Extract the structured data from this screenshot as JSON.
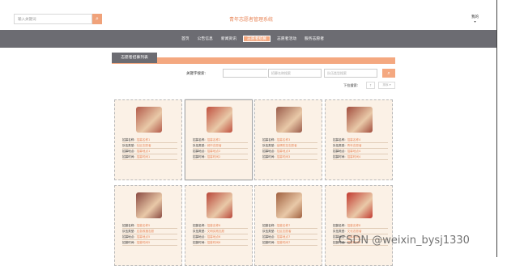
{
  "header": {
    "search_placeholder": "输入关键词",
    "search_icon": "search-icon",
    "title": "青年志愿者管理系统",
    "user_label": "我的",
    "user_caret": "▾"
  },
  "nav": {
    "items": [
      {
        "label": "首页"
      },
      {
        "label": "公告信息"
      },
      {
        "label": "新闻资讯"
      },
      {
        "label": "志愿者招募"
      },
      {
        "label": "志愿者活动"
      },
      {
        "label": "服务志愿者"
      }
    ]
  },
  "section": {
    "title": "志愿者招募列表"
  },
  "filters": {
    "keyword_label": "关键字搜索:",
    "placeholder_1": "招募编号搜索",
    "placeholder_2": "招募名称搜索",
    "placeholder_3": "队伍类型搜索",
    "search_icon": "search-icon"
  },
  "sort": {
    "label": "下拉搜索:",
    "up_label": "↑",
    "select_label": "排序 ▾"
  },
  "cards": [
    {
      "photo_color": "#b35a4a",
      "rows": [
        [
          "招募名称:",
          "招募名称1"
        ],
        [
          "队伍类型:",
          "社区志愿者"
        ],
        [
          "招募地点:",
          "招募地点1"
        ],
        [
          "招募时间:",
          "招募时间1"
        ]
      ]
    },
    {
      "photo_color": "#c0503f",
      "rows": [
        [
          "招募名称:",
          "招募名称2"
        ],
        [
          "队伍类型:",
          "城市志愿者"
        ],
        [
          "招募地点:",
          "招募地点2"
        ],
        [
          "招募时间:",
          "招募时间2"
        ]
      ]
    },
    {
      "photo_color": "#9a5b4a",
      "rows": [
        [
          "招募名称:",
          "招募名称3"
        ],
        [
          "队伍类型:",
          "疫情防控志愿者"
        ],
        [
          "招募地点:",
          "招募地点3"
        ],
        [
          "招募时间:",
          "招募时间3"
        ]
      ]
    },
    {
      "photo_color": "#a14b3c",
      "rows": [
        [
          "招募名称:",
          "招募名称4"
        ],
        [
          "队伍类型:",
          "青年志愿者"
        ],
        [
          "招募地点:",
          "招募地点4"
        ],
        [
          "招募时间:",
          "招募时间4"
        ]
      ]
    },
    {
      "photo_color": "#8a4a42",
      "rows": [
        [
          "招募名称:",
          "招募名称5"
        ],
        [
          "队伍类型:",
          "应急救援志愿"
        ],
        [
          "招募地点:",
          "招募地点5"
        ],
        [
          "招募时间:",
          "招募时间5"
        ]
      ]
    },
    {
      "photo_color": "#b9473a",
      "rows": [
        [
          "招募名称:",
          "招募名称6"
        ],
        [
          "队伍类型:",
          "文明实践志愿"
        ],
        [
          "招募地点:",
          "招募地点6"
        ],
        [
          "招募时间:",
          "招募时间6"
        ]
      ]
    },
    {
      "photo_color": "#a0603f",
      "rows": [
        [
          "招募名称:",
          "招募名称7"
        ],
        [
          "队伍类型:",
          "社区志愿者"
        ],
        [
          "招募地点:",
          "招募地点7"
        ],
        [
          "招募时间:",
          "招募时间7"
        ]
      ]
    },
    {
      "photo_color": "#c23a30",
      "rows": [
        [
          "招募名称:",
          "招募名称8"
        ],
        [
          "队伍类型:",
          "文化志愿者"
        ],
        [
          "招募地点:",
          "招募地点8"
        ],
        [
          "招募时间:",
          "招募时间8"
        ]
      ]
    }
  ],
  "watermark": "CSDN @weixin_bysj1330"
}
